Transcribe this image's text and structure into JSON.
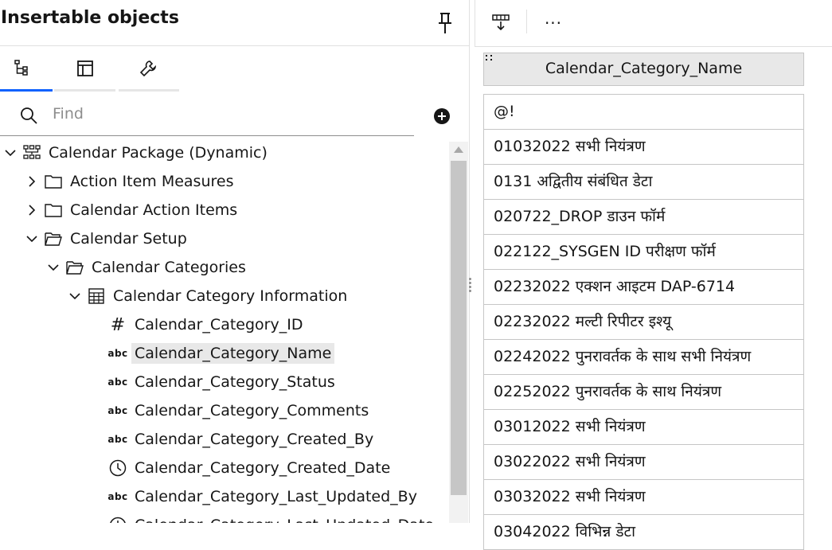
{
  "panel": {
    "title": "Insertable objects",
    "tabs": [
      {
        "id": "source-tree",
        "icon": "source-tree-icon",
        "active": true
      },
      {
        "id": "toolbox",
        "icon": "toolbox-icon",
        "active": false
      },
      {
        "id": "tools",
        "icon": "wrench-icon",
        "active": false
      }
    ]
  },
  "search": {
    "placeholder": "Find",
    "value": ""
  },
  "tree": [
    {
      "label": "Calendar Package (Dynamic)",
      "icon": "package-icon",
      "expanded": true,
      "depth": 0
    },
    {
      "label": "Action Item Measures",
      "icon": "folder-icon",
      "expanded": false,
      "depth": 1
    },
    {
      "label": "Calendar Action Items",
      "icon": "folder-icon",
      "expanded": false,
      "depth": 1
    },
    {
      "label": "Calendar Setup",
      "icon": "folder-open-icon",
      "expanded": true,
      "depth": 1
    },
    {
      "label": "Calendar Categories",
      "icon": "folder-open-icon",
      "expanded": true,
      "depth": 2
    },
    {
      "label": "Calendar Category Information",
      "icon": "table-icon",
      "expanded": true,
      "depth": 3
    },
    {
      "label": "Calendar_Category_ID",
      "icon": "number-icon",
      "depth": 4
    },
    {
      "label": "Calendar_Category_Name",
      "icon": "text-abc-icon",
      "depth": 4,
      "selected": true
    },
    {
      "label": "Calendar_Category_Status",
      "icon": "text-abc-icon",
      "depth": 4
    },
    {
      "label": "Calendar_Category_Comments",
      "icon": "text-abc-icon",
      "depth": 4
    },
    {
      "label": "Calendar_Category_Created_By",
      "icon": "text-abc-icon",
      "depth": 4
    },
    {
      "label": "Calendar_Category_Created_Date",
      "icon": "clock-icon",
      "depth": 4
    },
    {
      "label": "Calendar_Category_Last_Updated_By",
      "icon": "text-abc-icon",
      "depth": 4
    },
    {
      "label": "Calendar_Category_Last_Updated_Date",
      "icon": "clock-icon",
      "depth": 4
    }
  ],
  "abc_glyph": "abc",
  "number_glyph": "#",
  "list": {
    "header": "Calendar_Category_Name",
    "rows": [
      "@!",
      "01032022 सभी नियंत्रण",
      "0131 अद्वितीय संबंधित डेटा",
      "020722_DROP डाउन फॉर्म",
      "022122_SYSGEN ID परीक्षण फॉर्म",
      "02232022 एक्शन आइटम DAP-6714",
      "02232022 मल्टी रिपीटर इश्यू",
      "02242022 पुनरावर्तक के साथ सभी नियंत्रण",
      "02252022 पुनरावर्तक के साथ नियंत्रण",
      "03012022 सभी नियंत्रण",
      "03022022 सभी नियंत्रण",
      "03032022 सभी नियंत्रण",
      "03042022 विभिन्न डेटा"
    ]
  },
  "toolbar": {
    "more_label": "···"
  },
  "colors": {
    "accent": "#0f62fe",
    "selected": "#e8e8e8",
    "border": "#c6c6c6"
  }
}
